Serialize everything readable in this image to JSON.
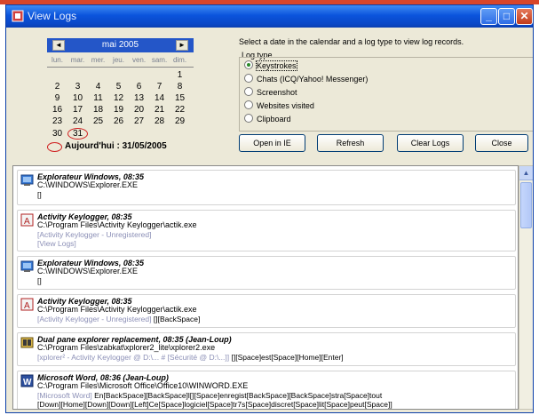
{
  "window": {
    "title": "View Logs"
  },
  "calendar": {
    "month_label": "mai 2005",
    "prev_label": "◄",
    "next_label": "►",
    "weekdays": [
      "lun.",
      "mar.",
      "mer.",
      "jeu.",
      "ven.",
      "sam.",
      "dim."
    ],
    "weeks": [
      [
        "",
        "",
        "",
        "",
        "",
        "",
        "1"
      ],
      [
        "2",
        "3",
        "4",
        "5",
        "6",
        "7",
        "8"
      ],
      [
        "9",
        "10",
        "11",
        "12",
        "13",
        "14",
        "15"
      ],
      [
        "16",
        "17",
        "18",
        "19",
        "20",
        "21",
        "22"
      ],
      [
        "23",
        "24",
        "25",
        "26",
        "27",
        "28",
        "29"
      ],
      [
        "30",
        "31",
        "",
        "",
        "",
        "",
        ""
      ]
    ],
    "today_label": "Aujourd'hui : 31/05/2005"
  },
  "instructions": "Select a date in the calendar and a log type to view log records.",
  "log_type": {
    "label": "Log type",
    "options": [
      "Keystrokes",
      "Chats (ICQ/Yahoo! Messenger)",
      "Screenshot",
      "Websites visited",
      "Clipboard"
    ],
    "selected": "Keystrokes"
  },
  "buttons": {
    "open": "Open in IE",
    "refresh": "Refresh",
    "clear": "Clear Logs",
    "close": "Close"
  },
  "entries": [
    {
      "icon": "explorer-icon",
      "title": "Explorateur Windows, 08:35",
      "path": "C:\\WINDOWS\\Explorer.EXE",
      "lines": [
        {
          "gray": "",
          "text": "[]"
        }
      ]
    },
    {
      "icon": "keylogger-icon",
      "title": "Activity Keylogger, 08:35",
      "path": "C:\\Program Files\\Activity Keylogger\\actik.exe",
      "lines": [
        {
          "gray": "[Activity Keylogger - Unregistered]",
          "text": ""
        },
        {
          "gray": "[View Logs]",
          "text": ""
        }
      ]
    },
    {
      "icon": "explorer-icon",
      "title": "Explorateur Windows, 08:35",
      "path": "C:\\WINDOWS\\Explorer.EXE",
      "lines": [
        {
          "gray": "",
          "text": "[]"
        }
      ]
    },
    {
      "icon": "keylogger-icon",
      "title": "Activity Keylogger, 08:35",
      "path": "C:\\Program Files\\Activity Keylogger\\actik.exe",
      "lines": [
        {
          "gray": "[Activity Keylogger - Unregistered]",
          "text": " [][BackSpace]"
        }
      ]
    },
    {
      "icon": "dual-pane-icon",
      "title": "Dual pane explorer replacement, 08:35 (Jean-Loup)",
      "path": "C:\\Program Files\\zabkat\\xplorer2_lite\\xplorer2.exe",
      "lines": [
        {
          "gray": "[xplorer² - Activity Keylogger @ D:\\... # [Sécurité @ D:\\...]]",
          "text": " [][Space]est[Space][Home][Enter]"
        }
      ]
    },
    {
      "icon": "word-icon",
      "title": "Microsoft Word, 08:36 (Jean-Loup)",
      "path": "C:\\Program Files\\Microsoft Office\\Office10\\WINWORD.EXE",
      "lines": [
        {
          "gray": "[Microsoft Word]",
          "text": " En[BackSpace][BackSpace]l[][Space]enregist[BackSpace][BackSpace]stra[Space]tout"
        },
        {
          "gray": "",
          "text": "[Down][Home][Down][Down][Left]Ce[Space]logiciel[Space]tr7s[Space]discret[Space]lit[Space]peut[Space]]"
        }
      ]
    }
  ],
  "colors": {
    "titlebar": "#0b54dc",
    "window_bg": "#ece9d8",
    "calendar_header": "#2456c8",
    "unregistered_text": "#8b8fb6"
  }
}
